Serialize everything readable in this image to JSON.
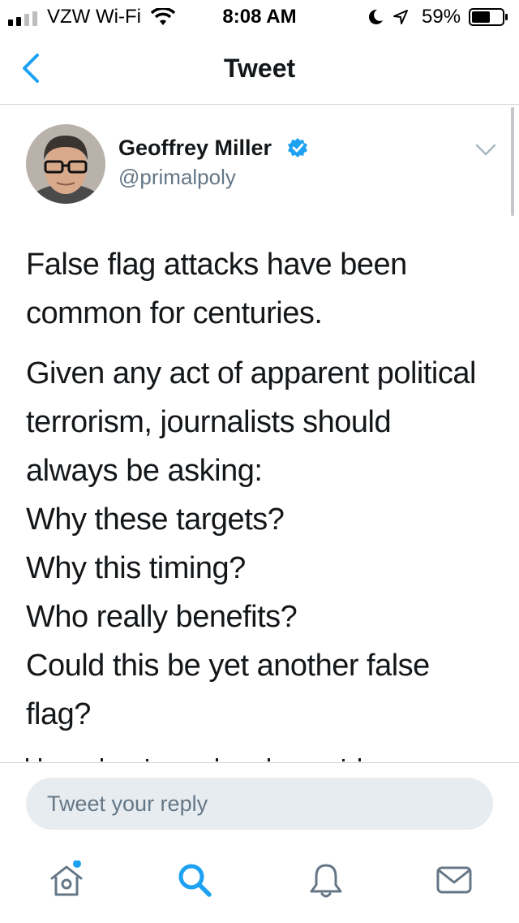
{
  "status_bar": {
    "carrier": "VZW Wi-Fi",
    "time": "8:08 AM",
    "battery_percent": "59%"
  },
  "nav": {
    "title": "Tweet",
    "back_icon": "chevron-left-icon"
  },
  "tweet": {
    "author_name": "Geoffrey Miller",
    "handle": "@primalpoly",
    "verified": true,
    "paragraph_1": [
      "False flag attacks have been",
      "common for centuries."
    ],
    "paragraph_2": [
      "Given any act of apparent political",
      "terrorism, journalists should",
      "always be asking:",
      "Why these targets?",
      "Why this timing?",
      "Who really benefits?",
      "Could this be yet another false",
      "flag?"
    ]
  },
  "reply": {
    "placeholder": "Tweet your reply"
  },
  "tabs": [
    {
      "name": "home",
      "icon": "home-icon",
      "has_notification_dot": true
    },
    {
      "name": "search",
      "icon": "search-icon",
      "active": true
    },
    {
      "name": "notifications",
      "icon": "bell-icon"
    },
    {
      "name": "messages",
      "icon": "mail-icon"
    }
  ],
  "colors": {
    "accent": "#1da1f2",
    "text_primary": "#14171a",
    "text_secondary": "#657786",
    "icon_gray": "#657786",
    "input_bg": "#e6ecf0"
  }
}
